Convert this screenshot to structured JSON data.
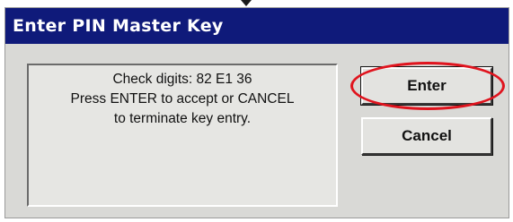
{
  "dialog": {
    "title": "Enter PIN Master Key",
    "message": {
      "line1": "Check digits: 82 E1 36",
      "line2": "Press ENTER to accept or CANCEL",
      "line3": "to terminate key entry."
    },
    "buttons": {
      "enter_label": "Enter",
      "cancel_label": "Cancel"
    }
  },
  "colors": {
    "titlebar": "#0f1a7a",
    "highlight": "#e0141e",
    "dialog_bg": "#d9d9d6"
  }
}
